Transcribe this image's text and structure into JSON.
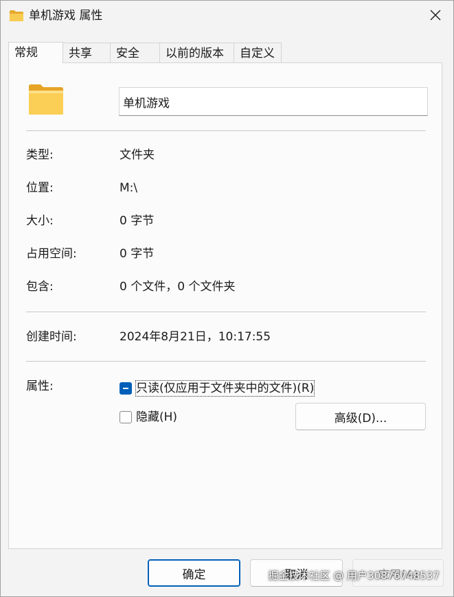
{
  "window": {
    "title": "单机游戏 属性"
  },
  "tabs": [
    {
      "label": "常规",
      "active": true
    },
    {
      "label": "共享",
      "active": false
    },
    {
      "label": "安全",
      "active": false
    },
    {
      "label": "以前的版本",
      "active": false
    },
    {
      "label": "自定义",
      "active": false
    }
  ],
  "general": {
    "name_value": "单机游戏",
    "props": {
      "type": {
        "label": "类型:",
        "value": "文件夹"
      },
      "location": {
        "label": "位置:",
        "value": "M:\\"
      },
      "size": {
        "label": "大小:",
        "value": "0 字节"
      },
      "size_on_disk": {
        "label": "占用空间:",
        "value": "0 字节"
      },
      "contains": {
        "label": "包含:",
        "value": "0 个文件，0 个文件夹"
      },
      "created": {
        "label": "创建时间:",
        "value": "2024年8月21日，10:17:55"
      }
    },
    "attributes": {
      "label": "属性:",
      "readonly": {
        "label": "只读(仅应用于文件夹中的文件)(R)",
        "state": "indeterminate"
      },
      "hidden": {
        "label": "隐藏(H)",
        "state": "unchecked"
      },
      "advanced_button": "高级(D)..."
    }
  },
  "buttons": {
    "ok": "确定",
    "cancel": "取消",
    "apply": "应用(A)"
  },
  "watermark": "掘金技术社区 @ 用户3087674853​7",
  "colors": {
    "accent": "#005fb8",
    "folder": "#f6c445"
  }
}
